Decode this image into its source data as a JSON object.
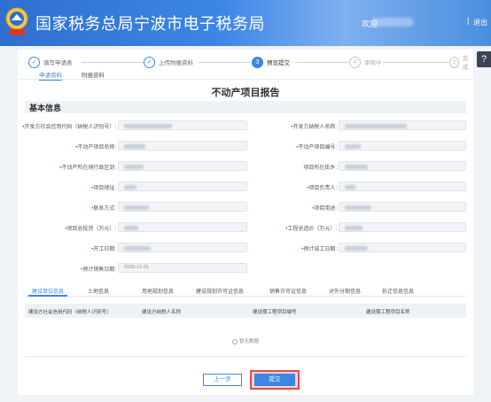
{
  "header": {
    "site_title": "国家税务总局宁波市电子税务局",
    "welcome": "欢迎",
    "separator": "|",
    "logout": "退出",
    "help_icon": "?"
  },
  "steps": [
    {
      "num": "✓",
      "label": "填写申请表",
      "state": "done"
    },
    {
      "num": "✓",
      "label": "上传附报资料",
      "state": "done"
    },
    {
      "num": "3",
      "label": "预览提交",
      "state": "active"
    },
    {
      "num": "4",
      "label": "审核中",
      "state": "todo"
    },
    {
      "num": "5",
      "label": "完成",
      "state": "todo"
    }
  ],
  "subtabs": [
    "申请资料",
    "附报资料"
  ],
  "report_title": "不动产项目报告",
  "section_title": "基本信息",
  "fields": [
    {
      "label": "开发方社会信用代码（纳税人识别号）:",
      "required": true,
      "value": ""
    },
    {
      "label": "开发方纳税人名称:",
      "required": true,
      "value": ""
    },
    {
      "label": "不动产项目名称:",
      "required": true,
      "value": ""
    },
    {
      "label": "不动产项目编号:",
      "required": true,
      "value": ""
    },
    {
      "label": "不动产所在地行政区划:",
      "required": true,
      "value": ""
    },
    {
      "label": "项目所在街乡:",
      "required": false,
      "value": ""
    },
    {
      "label": "项目地址:",
      "required": true,
      "value": ""
    },
    {
      "label": "项目负责人:",
      "required": true,
      "value": ""
    },
    {
      "label": "联系方式:",
      "required": true,
      "value": ""
    },
    {
      "label": "项目用途:",
      "required": true,
      "value": ""
    },
    {
      "label": "项目总投资（万元）:",
      "required": true,
      "value": ""
    },
    {
      "label": "工程总造价（万元）:",
      "required": true,
      "value": ""
    },
    {
      "label": "开工日期:",
      "required": true,
      "value": ""
    },
    {
      "label": "预计竣工日期:",
      "required": true,
      "value": ""
    },
    {
      "label": "预计销售日期:",
      "required": true,
      "value": "2020-12-31"
    }
  ],
  "info_tabs": [
    "建设单位信息",
    "土地信息",
    "用地规划信息",
    "建设规划许可证信息",
    "销售许可证信息",
    "对外分期信息",
    "拆迁信息信息"
  ],
  "table_headers": [
    "建设方社会信用代码（纳税人识别号）",
    "建设方纳税人名称",
    "建设期工程项目编号",
    "建设期工程项目名称"
  ],
  "no_data": "暂无数据",
  "buttons": {
    "prev": "上一步",
    "submit": "提交"
  }
}
